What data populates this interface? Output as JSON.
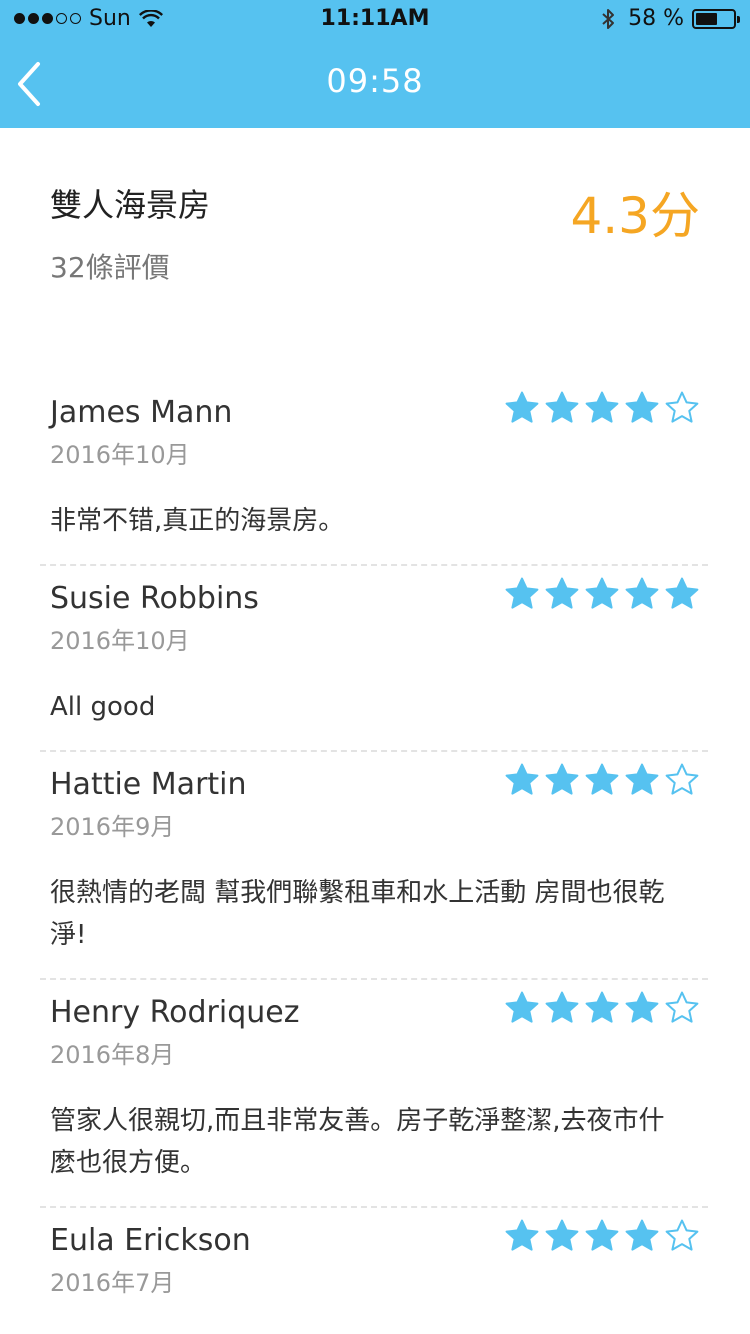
{
  "status_bar": {
    "carrier": "Sun",
    "time": "11:11AM",
    "battery_pct": "58 %",
    "battery_level": 0.58
  },
  "nav": {
    "title": "09:58",
    "back_icon": "chevron-left-icon"
  },
  "summary": {
    "room_name": "雙人海景房",
    "review_count": "32條評價",
    "score": "4.3分"
  },
  "colors": {
    "header": "#56c2f0",
    "score": "#f5a623",
    "star": "#56c2f0"
  },
  "reviews": [
    {
      "name": "James Mann",
      "date": "2016年10月",
      "rating": 4,
      "text": "非常不错,真正的海景房。"
    },
    {
      "name": "Susie Robbins",
      "date": "2016年10月",
      "rating": 5,
      "text": "All good"
    },
    {
      "name": "Hattie Martin",
      "date": "2016年9月",
      "rating": 4,
      "text": "很熱情的老闆 幫我們聯繫租車和水上活動 房間也很乾淨!"
    },
    {
      "name": "Henry Rodriquez",
      "date": "2016年8月",
      "rating": 4,
      "text": "管家人很親切,而且非常友善。房子乾淨整潔,去夜市什麼也很方便。"
    },
    {
      "name": "Eula Erickson",
      "date": "2016年7月",
      "rating": 4,
      "text": ""
    }
  ]
}
